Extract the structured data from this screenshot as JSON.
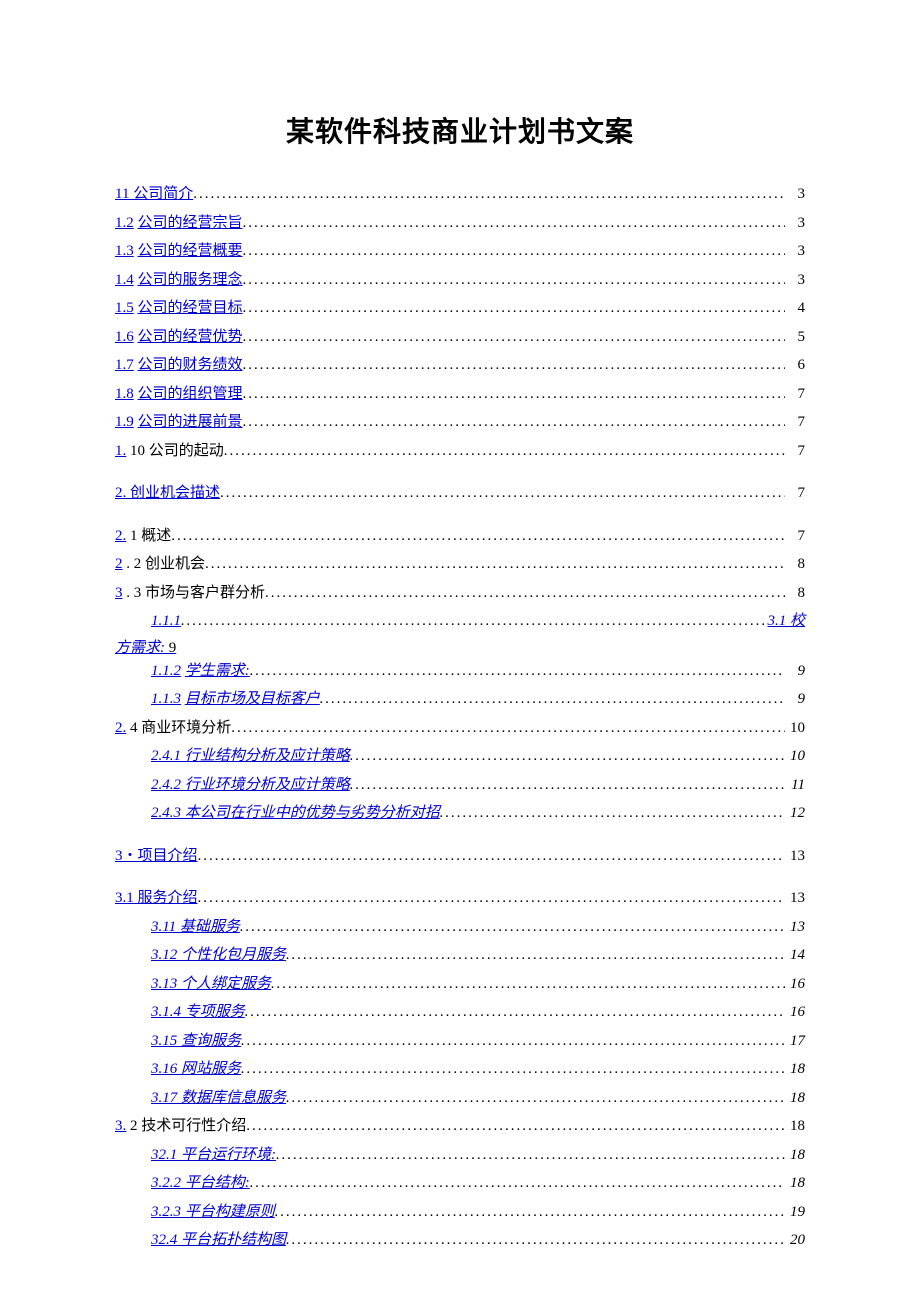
{
  "title": "某软件科技商业计划书文案",
  "toc": [
    {
      "indent": 1,
      "label_link": "11 公司简介",
      "page": "3",
      "italic": false
    },
    {
      "indent": 1,
      "label_link": "1.2",
      "label_link2": "公司的经营宗旨",
      "page": "3",
      "italic": false,
      "split": true
    },
    {
      "indent": 1,
      "label_link": "1.3",
      "label_link2": "公司的经营概要",
      "page": "3",
      "italic": false,
      "split": true
    },
    {
      "indent": 1,
      "label_link": "1.4",
      "label_link2": "公司的服务理念",
      "page": "3",
      "italic": false,
      "split": true
    },
    {
      "indent": 1,
      "label_link": "1.5",
      "label_link2": "公司的经营目标",
      "page": "4",
      "italic": false,
      "split": true
    },
    {
      "indent": 1,
      "label_link": "1.6",
      "label_link2": "公司的经营优势",
      "page": "5",
      "italic": false,
      "split": true
    },
    {
      "indent": 1,
      "label_link": "1.7",
      "label_link2": "公司的财务绩效",
      "page": "6",
      "italic": false,
      "split": true
    },
    {
      "indent": 1,
      "label_link": "1.8",
      "label_link2": "公司的组织管理",
      "page": "7",
      "italic": false,
      "split": true
    },
    {
      "indent": 1,
      "label_link": "1.9",
      "label_link2": "公司的进展前景",
      "page": "7",
      "italic": false,
      "split": true
    },
    {
      "indent": 1,
      "label_link": "1.",
      "label_plain": " 10 公司的起动",
      "page": "7",
      "italic": false
    },
    {
      "indent": 0,
      "label_link": "2. 创业机会描述",
      "page": "7",
      "italic": false,
      "gap": true
    },
    {
      "indent": 1,
      "label_link": "2.",
      "label_plain": " 1 概述",
      "page": "7",
      "italic": false,
      "gap": true
    },
    {
      "indent": 1,
      "label_link": "2",
      "label_plain": " . 2 创业机会",
      "page": "8",
      "italic": false
    },
    {
      "indent": 1,
      "label_link": "3",
      "label_plain": " . 3 市场与客户群分析",
      "page": "8",
      "italic": false
    },
    {
      "special": "wrap",
      "line1_link": "1.1.1",
      "line1_trail_link": "3.1 校",
      "line2_link": "方需求:",
      "line2_page": "9"
    },
    {
      "indent": 2,
      "label_link": "1.1.2",
      "label_link2": "学生需求:",
      "page": "9",
      "italic": true,
      "split": true
    },
    {
      "indent": 2,
      "label_link": "1.1.3",
      "label_link2": "目标市场及目标客户",
      "page": "9",
      "italic": true,
      "split": true
    },
    {
      "indent": 1,
      "label_link": "2.",
      "label_plain": " 4 商业环境分析",
      "page": "10",
      "italic": false
    },
    {
      "indent": 2,
      "label_link": "2.4.1 行业结构分析及应计策略",
      "page": "10",
      "italic": true
    },
    {
      "indent": 2,
      "label_link": "2.4.2 行业环境分析及应计策略",
      "page": "11",
      "italic": true
    },
    {
      "indent": 2,
      "label_link": "2.4.3 本公司在行业中的优势与劣势分析对招",
      "page": "12",
      "italic": true
    },
    {
      "indent": 0,
      "label_link": "3・项目介绍",
      "page": "13",
      "italic": false,
      "gap": true
    },
    {
      "indent": 1,
      "label_link": "3.1 服务介绍",
      "page": "13",
      "italic": false,
      "gap": true
    },
    {
      "indent": 2,
      "label_link": "3.11 基础服务",
      "page": "13",
      "italic": true
    },
    {
      "indent": 2,
      "label_link": "3.12 个性化包月服务",
      "page": "14",
      "italic": true
    },
    {
      "indent": 2,
      "label_link": "3.13 个人绑定服务",
      "page": "16",
      "italic": true
    },
    {
      "indent": 2,
      "label_link": "3.1.4 专项服务",
      "page": "16",
      "italic": true
    },
    {
      "indent": 2,
      "label_link": "3.15 查询服务",
      "page": "17",
      "italic": true
    },
    {
      "indent": 2,
      "label_link": "3.16 网站服务",
      "page": "18",
      "italic": true
    },
    {
      "indent": 2,
      "label_link": "3.17 数据库信息服务",
      "page": "18",
      "italic": true
    },
    {
      "indent": 1,
      "label_link": "3.",
      "label_plain": " 2 技术可行性介绍",
      "page": "18",
      "italic": false
    },
    {
      "indent": 2,
      "label_link": "3",
      "label_link_after_plain": "2.1 平台运行环境:",
      "page": "18",
      "italic": true,
      "concat": true
    },
    {
      "indent": 2,
      "label_link": "3.2.2 平台结构:",
      "page": "18",
      "italic": true
    },
    {
      "indent": 2,
      "label_link": "3.2.3 平台构建原则",
      "page": "19",
      "italic": true
    },
    {
      "indent": 2,
      "label_link": "3",
      "label_link_after_plain": "2.4 平台拓扑结构图",
      "page": "20",
      "italic": true,
      "concat": true
    }
  ]
}
